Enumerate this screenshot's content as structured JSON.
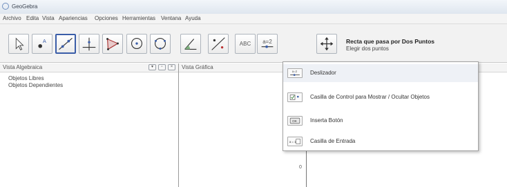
{
  "window": {
    "title": "GeoGebra"
  },
  "menu": [
    "Archivo",
    "Edita",
    "Vista",
    "Apariencias",
    "Opciones",
    "Herramientas",
    "Ventana",
    "Ayuda"
  ],
  "toolbar": {
    "slider_tool_text": "a=2",
    "text_tool_text": "ABC",
    "active_tool_name": "Recta que pasa por Dos Puntos",
    "active_tool_hint": "Elegir dos puntos"
  },
  "algebra_view": {
    "title": "Vista Algebraica",
    "items": [
      "Objetos Libres",
      "Objetos Dependientes"
    ]
  },
  "graphics_view": {
    "title": "Vista Gráfica",
    "axis_zero": "0"
  },
  "dropdown": {
    "items": [
      {
        "label": "Deslizador",
        "icon": "slider-icon",
        "icon_text": "a=2"
      },
      {
        "label": "Casilla de Control para Mostrar / Ocultar Objetos",
        "icon": "checkbox-icon"
      },
      {
        "label": "Inserta Botón",
        "icon": "button-icon",
        "icon_text": "OK"
      },
      {
        "label": "Casilla de Entrada",
        "icon": "input-box-icon",
        "icon_text": "a = 1"
      }
    ]
  }
}
